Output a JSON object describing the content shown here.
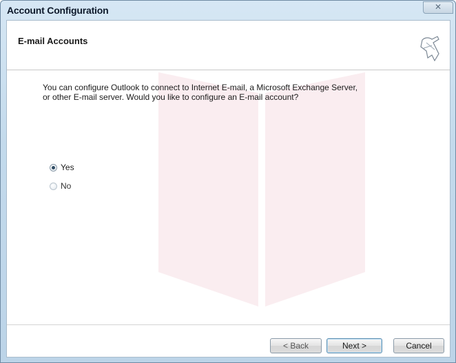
{
  "window": {
    "title": "Account Configuration",
    "close_symbol": "✕"
  },
  "header": {
    "section_title": "E-mail Accounts",
    "icon": "wizard-mail-icon"
  },
  "body": {
    "description": "You can configure Outlook to connect to Internet E-mail, a Microsoft Exchange Server, or other E-mail server. Would you like to configure an E-mail account?",
    "options": [
      {
        "label": "Yes",
        "selected": true
      },
      {
        "label": "No",
        "selected": false
      }
    ]
  },
  "footer": {
    "back_label": "< Back",
    "next_label": "Next >",
    "cancel_label": "Cancel"
  },
  "colors": {
    "title_bar": "#c3daec",
    "client_bg": "#ffffff",
    "default_button_border": "#5f8fb0"
  }
}
